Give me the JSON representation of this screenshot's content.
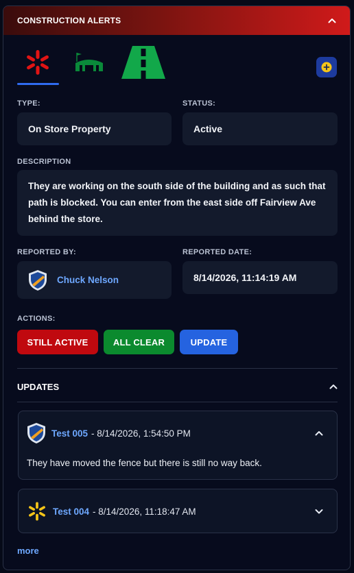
{
  "header": {
    "title": "CONSTRUCTION ALERTS"
  },
  "icons": {
    "tab_1": "walmart-spark-icon",
    "tab_2": "warehouse-icon",
    "tab_3": "road-icon",
    "add": "add-icon",
    "header_toggle": "chevron-up-icon"
  },
  "fields": {
    "type_label": "TYPE:",
    "type_value": "On Store Property",
    "status_label": "STATUS:",
    "status_value": "Active",
    "description_label": "DESCRIPTION",
    "description_value": "They are working on the south side of the building and as such that path is blocked. You can enter from the east side off Fairview Ave behind the store.",
    "reported_by_label": "REPORTED BY:",
    "reported_by_value": "Chuck Nelson",
    "reported_date_label": "REPORTED DATE:",
    "reported_date_value": "8/14/2026, 11:14:19 AM"
  },
  "actions": {
    "label": "ACTIONS:",
    "still_active": "STILL ACTIVE",
    "all_clear": "ALL CLEAR",
    "update": "UPDATE"
  },
  "updates": {
    "title": "UPDATES",
    "items": [
      {
        "author": "Test 005",
        "date": "- 8/14/2026, 1:54:50 PM",
        "body": "They have moved the fence but there is still no way back.",
        "expanded": true,
        "avatar": "shield-avatar-icon"
      },
      {
        "author": "Test 004",
        "date": "- 8/14/2026, 11:18:47 AM",
        "body": "",
        "expanded": false,
        "avatar": "walmart-spark-icon"
      }
    ],
    "more": "more"
  },
  "colors": {
    "still_active": "#c0090f",
    "all_clear": "#0b8a2e",
    "update": "#2563e0",
    "link": "#6ea8ff",
    "tab_underline": "#2f6bf0"
  }
}
